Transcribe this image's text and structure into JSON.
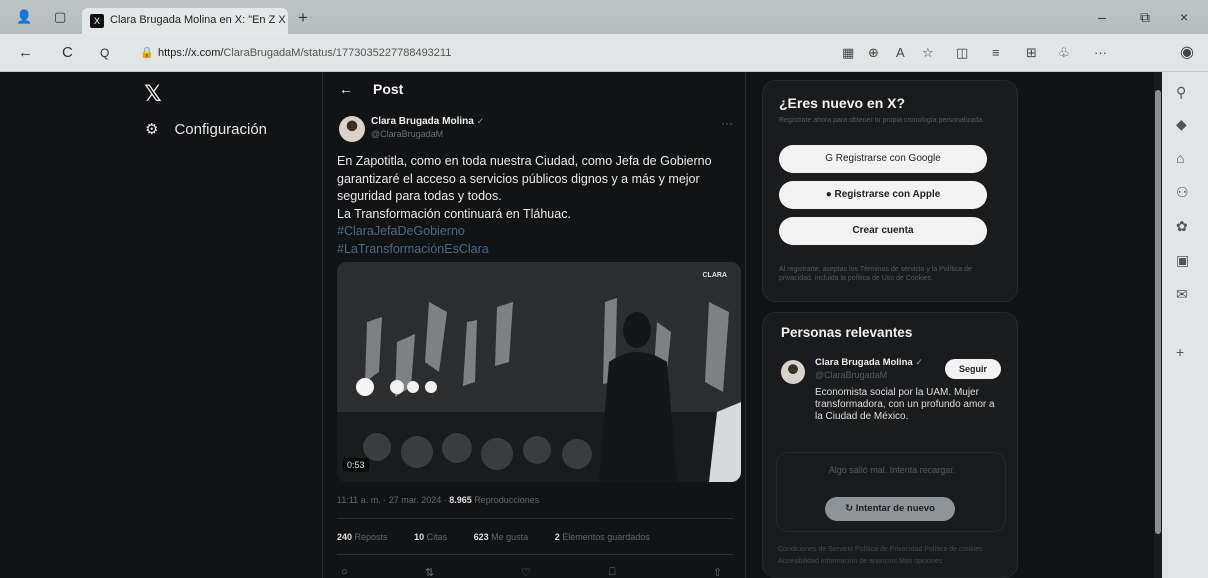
{
  "browser": {
    "tab_title": "Clara Brugada Molina en X: \"En Z X",
    "tab_close": "×",
    "new_tab": "+",
    "url_host": "https://x.com/",
    "url_path": "ClaraBrugadaM/status/1773035227788493211",
    "window_controls": {
      "minimize": "–",
      "restore": "⧉",
      "close": "×"
    },
    "nav": {
      "back": "←",
      "reload": "C",
      "search": "Q"
    },
    "toolbar_icons": [
      "reader-icon",
      "zoom-icon",
      "read-aloud-icon",
      "favorite-icon",
      "split-icon",
      "collections-icon",
      "extensions-icon",
      "copilot-icon",
      "more-icon",
      "profile-icon"
    ]
  },
  "x_sidebar": {
    "logo": "𝕏",
    "settings_label": "Configuración",
    "settings_icon": "⚙"
  },
  "post": {
    "header": "Post",
    "back_arrow": "←",
    "author_name": "Clara Brugada Molina",
    "author_verified": "✓",
    "author_handle": "@ClaraBrugadaM",
    "more": "···",
    "text": "En Zapotitla, como en toda nuestra Ciudad, como Jefa de Gobierno garantizaré el acceso a servicios públicos dignos y a más y mejor seguridad para todas y todos.\nLa Transformación continuará en Tláhuac.",
    "hashtags": [
      "#ClaraJefaDeGobierno",
      "#LaTransformaciónEsClara"
    ],
    "video_duration": "0:53",
    "video_brand": "CLARA",
    "timestamp": "11:11 a. m. · 27 mar. 2024 · ",
    "views_count": "8.965",
    "views_label": " Reproducciones",
    "stats": [
      {
        "count": "240",
        "label": " Reposts"
      },
      {
        "count": "10",
        "label": " Citas"
      },
      {
        "count": "623",
        "label": " Me gusta"
      },
      {
        "count": "2",
        "label": " Elementos guardados"
      }
    ],
    "actions": [
      "○",
      "⇅",
      "♡",
      "⎕",
      "⇧"
    ]
  },
  "signup": {
    "title": "¿Eres nuevo en X?",
    "subtitle": "Regístrate ahora para obtener tu propia cronología personalizada.",
    "google_button": "Registrarse con Google",
    "google_icon": "G",
    "apple_button": "Registrarse con Apple",
    "apple_icon": "",
    "create_account": "Crear cuenta",
    "legal": "Al registrarte, aceptas los Términos de servicio y la Política de privacidad, incluida la política de Uso de Cookies."
  },
  "relevant": {
    "title": "Personas relevantes",
    "name": "Clara Brugada Molina",
    "verified": "✓",
    "handle": "@ClaraBrugadaM",
    "follow_label": "Seguir",
    "bio": "Economista social por la UAM. Mujer transformadora, con un profundo amor a la Ciudad de México."
  },
  "error_state": {
    "message": "Algo salió mal. Intenta recargar.",
    "retry_label": "Intentar de nuevo",
    "retry_icon": "↻"
  },
  "footer": {
    "links": "Condiciones de Servicio  Política de Privacidad  Política de cookies  Accesibilidad  Información de anuncios  Más opciones"
  },
  "colors": {
    "page_bg": "#121314",
    "accent_link": "#4a6a88",
    "pill_bg": "#f3f3f3"
  }
}
